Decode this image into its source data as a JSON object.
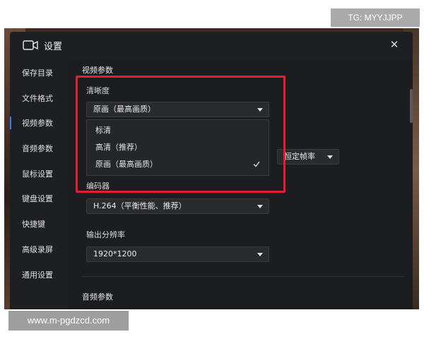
{
  "watermark_top": "TG: MYYJJPP",
  "watermark_bottom": "www.m-pgdzcd.com",
  "window": {
    "title": "设置",
    "close_glyph": "✕"
  },
  "sidebar": {
    "items": [
      {
        "label": "保存目录"
      },
      {
        "label": "文件格式"
      },
      {
        "label": "视频参数",
        "active": true
      },
      {
        "label": "音频参数"
      },
      {
        "label": "鼠标设置"
      },
      {
        "label": "键盘设置"
      },
      {
        "label": "快捷键"
      },
      {
        "label": "高级录屏"
      },
      {
        "label": "通用设置"
      }
    ]
  },
  "video_params": {
    "section_title": "视频参数",
    "clarity": {
      "label": "清晰度",
      "selected": "原画（最高画质）",
      "options": [
        "标清",
        "高清（推荐）",
        "原画（最高画质）"
      ],
      "checked_index": 2
    },
    "frame_rate": {
      "selected": "恒定帧率"
    },
    "encoder": {
      "label": "编码器",
      "selected": "H.264（平衡性能、推荐）"
    },
    "resolution": {
      "label": "输出分辨率",
      "selected": "1920*1200"
    }
  },
  "audio_params": {
    "section_title": "音频参数"
  },
  "colors": {
    "accent": "#2f7cf6",
    "highlight": "#e1202a",
    "window_bg": "#1e1f22"
  }
}
